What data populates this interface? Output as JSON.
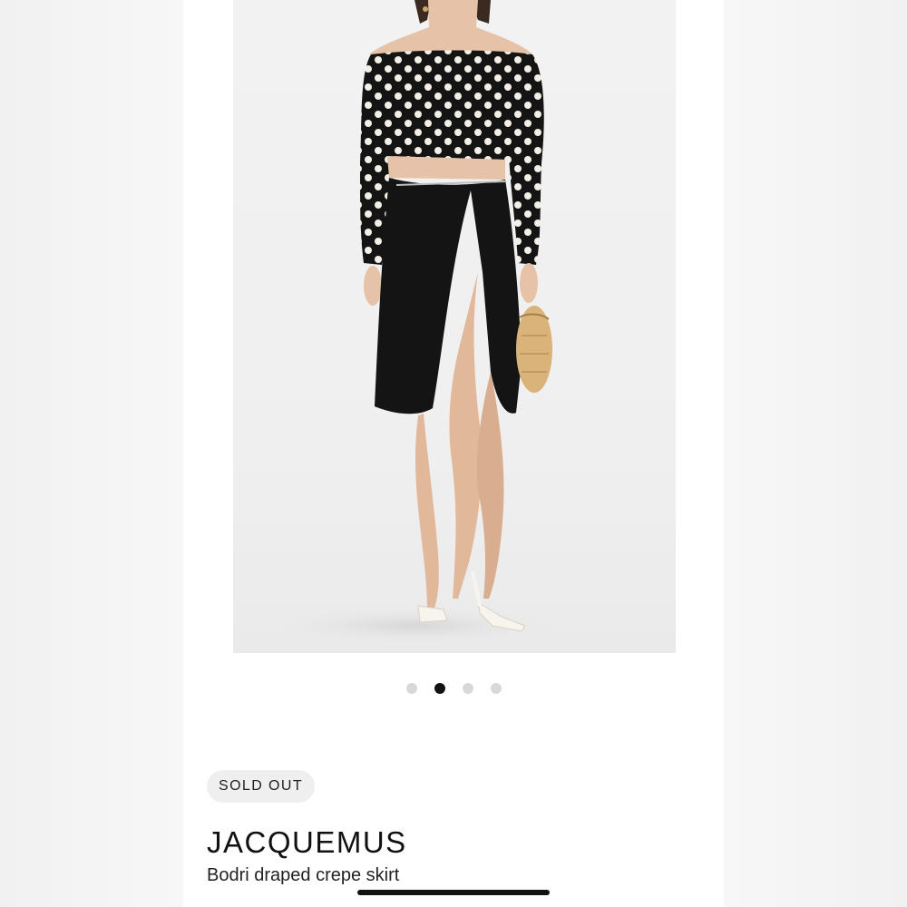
{
  "product": {
    "status_badge": "SOLD OUT",
    "brand": "JACQUEMUS",
    "name": "Bodri draped crepe skirt",
    "image_alt": "Model wearing polka dot off-shoulder top and black draped crepe skirt with side slit, white heels and woven basket bag"
  },
  "gallery": {
    "total_images": 4,
    "active_index": 1
  },
  "colors": {
    "badge_bg": "#efefef",
    "active_dot": "#111111",
    "inactive_dot": "#d8d8d8"
  }
}
